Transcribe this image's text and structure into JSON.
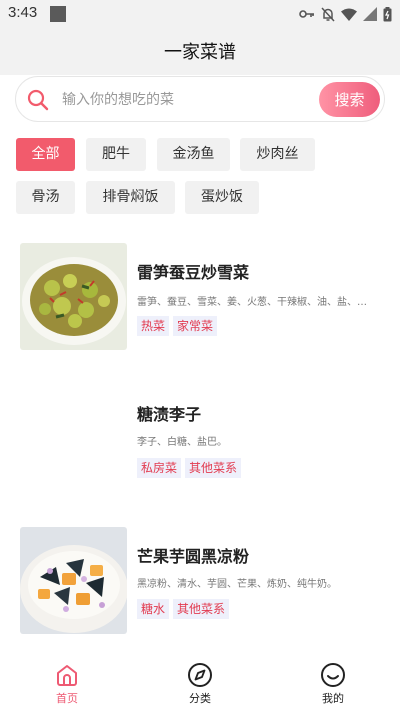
{
  "status_bar": {
    "time": "3:43"
  },
  "header": {
    "title": "一家菜谱"
  },
  "search": {
    "placeholder": "输入你的想吃的菜",
    "button_label": "搜索"
  },
  "categories": [
    {
      "label": "全部",
      "active": true
    },
    {
      "label": "肥牛"
    },
    {
      "label": "金汤鱼"
    },
    {
      "label": "炒肉丝"
    },
    {
      "label": "骨汤"
    },
    {
      "label": "排骨焖饭"
    },
    {
      "label": "蛋炒饭"
    }
  ],
  "recipes": [
    {
      "title": "雷笋蚕豆炒雪菜",
      "ingredients": "雷笋、蚕豆、雪菜、姜、火葱、干辣椒、油、盐、…",
      "tags": [
        "热菜",
        "家常菜"
      ]
    },
    {
      "title": "糖渍李子",
      "ingredients": "李子、白糖、盐巴。",
      "tags": [
        "私房菜",
        "其他菜系"
      ]
    },
    {
      "title": "芒果芋圆黑凉粉",
      "ingredients": "黑凉粉、清水、芋圆、芒果、炼奶、纯牛奶。",
      "tags": [
        "糖水",
        "其他菜系"
      ]
    }
  ],
  "nav": [
    {
      "label": "首页",
      "icon": "home-icon",
      "active": true
    },
    {
      "label": "分类",
      "icon": "compass-icon"
    },
    {
      "label": "我的",
      "icon": "smiley-icon"
    }
  ],
  "colors": {
    "accent": "#f25b6c",
    "tag_text": "#e23b50",
    "tag_bg": "#eef0fb"
  }
}
